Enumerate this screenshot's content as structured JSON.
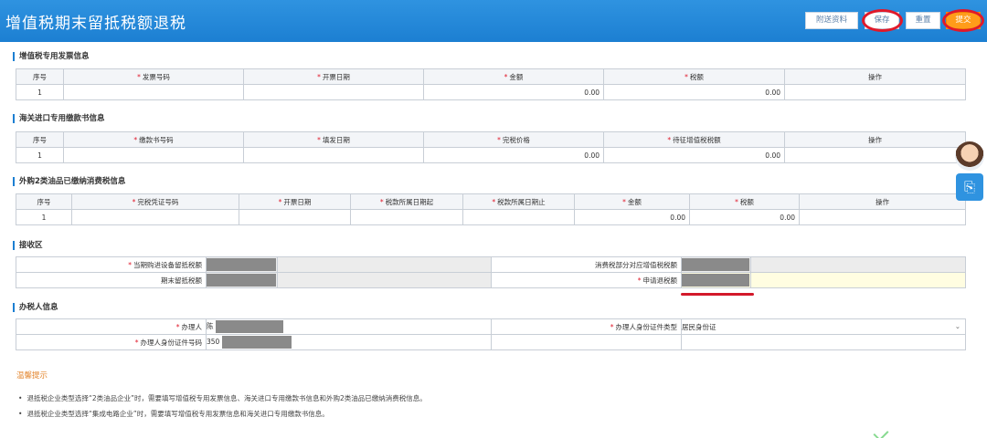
{
  "header": {
    "title": "增值税期末留抵税额退税",
    "buttons": {
      "attach": "附送资料",
      "save": "保存",
      "reset": "重置",
      "submit": "提交"
    }
  },
  "vat_invoice": {
    "title": "增值税专用发票信息",
    "columns": [
      "序号",
      "发票号码",
      "开票日期",
      "金额",
      "税额",
      "操作"
    ],
    "rows": [
      [
        "1",
        "",
        "",
        "0.00",
        "0.00",
        ""
      ]
    ]
  },
  "customs": {
    "title": "海关进口专用缴款书信息",
    "columns": [
      "序号",
      "缴款书号码",
      "填发日期",
      "完税价格",
      "待征增值税税额",
      "操作"
    ],
    "rows": [
      [
        "1",
        "",
        "",
        "0.00",
        "0.00",
        ""
      ]
    ]
  },
  "oil": {
    "title": "外购2类油品已缴纳消费税信息",
    "columns": [
      "序号",
      "完税凭证号码",
      "开票日期",
      "税款所属日期起",
      "税款所属日期止",
      "金额",
      "税额",
      "操作"
    ],
    "rows": [
      [
        "1",
        "",
        "",
        "",
        "",
        "0.00",
        "0.00",
        ""
      ]
    ]
  },
  "receipt": {
    "title": "接收区",
    "current_equipment_label": "当期购进设备留抵税额",
    "consumption_tax_label": "消费税部分对应增值税税额",
    "period_end_label": "期末留抵税额",
    "apply_refund_label": "申请退税额"
  },
  "agent": {
    "title": "办税人信息",
    "name_label": "办理人",
    "name_prefix": "陈",
    "id_type_label": "办理人身份证件类型",
    "id_type_value": "居民身份证",
    "id_no_label": "办理人身份证件号码",
    "id_no_prefix": "350"
  },
  "tips": {
    "title": "温馨提示",
    "items": [
      "退抵税企业类型选择“2类油品企业”时，需要填写增值税专用发票信息、海关进口专用缴款书信息和外购2类油品已缴纳消费税信息。",
      "退抵税企业类型选择“集成电路企业”时，需要填写增值税专用发票信息和海关进口专用缴款书信息。"
    ]
  },
  "colors": {
    "header": "#1c7fd2",
    "submit": "#ff9c1a",
    "highlight_ring": "#e0192a",
    "tip_title": "#e3842b"
  },
  "icons": {
    "side_button": "document-search-icon",
    "assistant": "avatar-icon"
  }
}
